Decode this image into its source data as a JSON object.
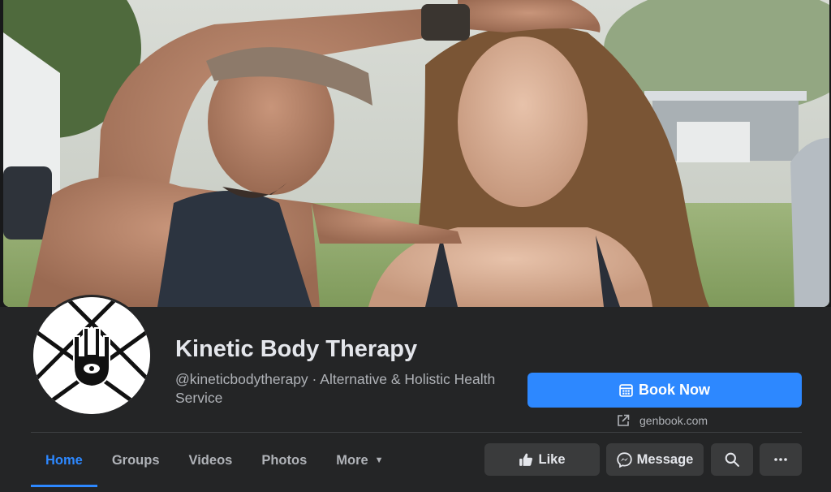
{
  "cover": {
    "alt": "cover-photo"
  },
  "page": {
    "name": "Kinetic Body Therapy",
    "handle_line": "@kineticbodytherapy · Alternative & Holistic Health Service"
  },
  "cta": {
    "label": "Book Now",
    "link_text": "genbook.com"
  },
  "tabs": [
    {
      "label": "Home",
      "active": true
    },
    {
      "label": "Groups"
    },
    {
      "label": "Videos"
    },
    {
      "label": "Photos"
    },
    {
      "label": "More"
    }
  ],
  "actions": {
    "like_label": "Like",
    "message_label": "Message"
  },
  "icons": {
    "book": "calendar-icon",
    "link": "external-link-icon",
    "like": "thumbs-up-icon",
    "message": "messenger-icon",
    "search": "search-icon",
    "more": "ellipsis-icon",
    "tab_more": "caret-down-icon"
  },
  "colors": {
    "accent": "#2d88ff",
    "background": "#242526",
    "button_bg": "#3a3b3c"
  }
}
